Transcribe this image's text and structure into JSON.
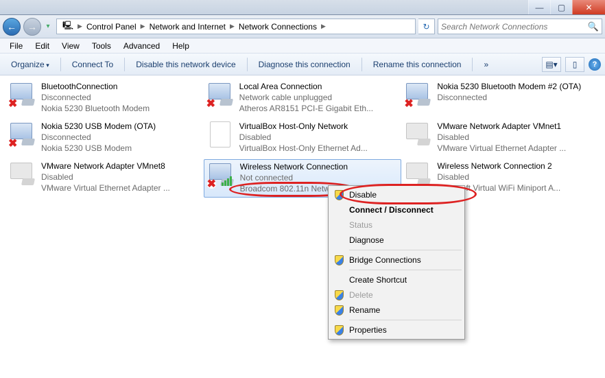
{
  "breadcrumb": [
    "Control Panel",
    "Network and Internet",
    "Network Connections"
  ],
  "search_placeholder": "Search Network Connections",
  "menubar": [
    "File",
    "Edit",
    "View",
    "Tools",
    "Advanced",
    "Help"
  ],
  "toolbar": {
    "organize": "Organize",
    "connect": "Connect To",
    "disable": "Disable this network device",
    "diagnose": "Diagnose this connection",
    "rename": "Rename this connection",
    "more": "»"
  },
  "connections": [
    {
      "name": "BluetoothConnection",
      "status": "Disconnected",
      "device": "Nokia 5230 Bluetooth Modem",
      "icon": "net-x",
      "selected": false
    },
    {
      "name": "Local Area Connection",
      "status": "Network cable unplugged",
      "device": "Atheros AR8151 PCI-E Gigabit Eth...",
      "icon": "net-x",
      "selected": false
    },
    {
      "name": "Nokia 5230 Bluetooth Modem #2 (OTA)",
      "status": "Disconnected",
      "device": "",
      "icon": "net-x",
      "selected": false
    },
    {
      "name": "Nokia 5230 USB Modem (OTA)",
      "status": "Disconnected",
      "device": "Nokia 5230 USB Modem",
      "icon": "net-x",
      "selected": false
    },
    {
      "name": "VirtualBox Host-Only Network",
      "status": "Disabled",
      "device": "VirtualBox Host-Only Ethernet Ad...",
      "icon": "blank",
      "selected": false
    },
    {
      "name": "VMware Network Adapter VMnet1",
      "status": "Disabled",
      "device": "VMware Virtual Ethernet Adapter ...",
      "icon": "disabled",
      "selected": false
    },
    {
      "name": "VMware Network Adapter VMnet8",
      "status": "Disabled",
      "device": "VMware Virtual Ethernet Adapter ...",
      "icon": "disabled",
      "selected": false
    },
    {
      "name": "Wireless Network Connection",
      "status": "Not connected",
      "device": "Broadcom 802.11n Netwo...",
      "icon": "wifi-x",
      "selected": true
    },
    {
      "name": "Wireless Network Connection 2",
      "status": "Disabled",
      "device": "Microsoft Virtual WiFi Miniport A...",
      "icon": "disabled",
      "selected": false
    }
  ],
  "context_menu": [
    {
      "label": "Disable",
      "icon": "shield",
      "bold": false,
      "enabled": true
    },
    {
      "label": "Connect / Disconnect",
      "bold": true,
      "enabled": true
    },
    {
      "label": "Status",
      "enabled": false
    },
    {
      "label": "Diagnose",
      "enabled": true
    },
    {
      "sep": true
    },
    {
      "label": "Bridge Connections",
      "icon": "shield",
      "enabled": true
    },
    {
      "sep": true
    },
    {
      "label": "Create Shortcut",
      "enabled": true
    },
    {
      "label": "Delete",
      "icon": "shield",
      "enabled": false
    },
    {
      "label": "Rename",
      "icon": "shield",
      "enabled": true
    },
    {
      "sep": true
    },
    {
      "label": "Properties",
      "icon": "shield",
      "enabled": true
    }
  ]
}
